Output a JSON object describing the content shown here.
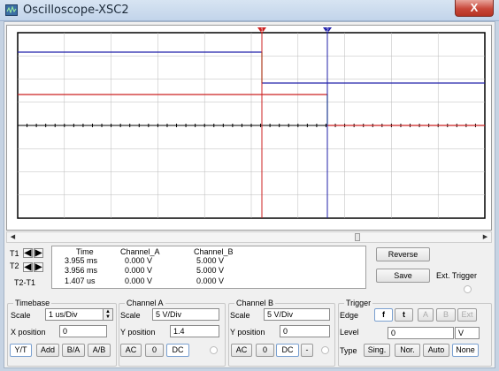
{
  "window": {
    "title": "Oscilloscope-XSC2",
    "close_label": "X"
  },
  "cursors": {
    "t1_label": "T1",
    "t2_label": "T2",
    "diff_label": "T2-T1",
    "left_arrow": "◀",
    "right_arrow": "▶",
    "t1_marker": "1",
    "t2_marker": "2"
  },
  "readout": {
    "headers": [
      "Time",
      "Channel_A",
      "Channel_B"
    ],
    "rows": [
      [
        "3.955 ms",
        "0.000 V",
        "5.000 V"
      ],
      [
        "3.956 ms",
        "0.000 V",
        "5.000 V"
      ],
      [
        "1.407 us",
        "0.000 V",
        "0.000 V"
      ]
    ]
  },
  "buttons": {
    "reverse": "Reverse",
    "save": "Save",
    "ext_trigger": "Ext. Trigger"
  },
  "timebase": {
    "title": "Timebase",
    "scale_label": "Scale",
    "scale_value": "1 us/Div",
    "xpos_label": "X position",
    "xpos_value": "0",
    "modes": [
      "Y/T",
      "Add",
      "B/A",
      "A/B"
    ]
  },
  "channel_a": {
    "title": "Channel A",
    "scale_label": "Scale",
    "scale_value": "5  V/Div",
    "ypos_label": "Y position",
    "ypos_value": "1.4",
    "coupling": [
      "AC",
      "0",
      "DC"
    ]
  },
  "channel_b": {
    "title": "Channel B",
    "scale_label": "Scale",
    "scale_value": "5  V/Div",
    "ypos_label": "Y position",
    "ypos_value": "0",
    "coupling": [
      "AC",
      "0",
      "DC",
      "-"
    ]
  },
  "trigger": {
    "title": "Trigger",
    "edge_label": "Edge",
    "edge_buttons": [
      "f",
      "t",
      "A",
      "B",
      "Ext"
    ],
    "level_label": "Level",
    "level_value": "0",
    "level_unit": "V",
    "type_label": "Type",
    "types": [
      "Sing.",
      "Nor.",
      "Auto",
      "None"
    ]
  },
  "colors": {
    "channel_a": "#cc2020",
    "channel_b": "#2020aa",
    "cursor_1": "#cc2020",
    "cursor_2": "#2020aa",
    "transition": "#20cc20",
    "axis": "#000000"
  },
  "icons": {
    "app": "oscilloscope-icon",
    "close": "close-icon"
  }
}
